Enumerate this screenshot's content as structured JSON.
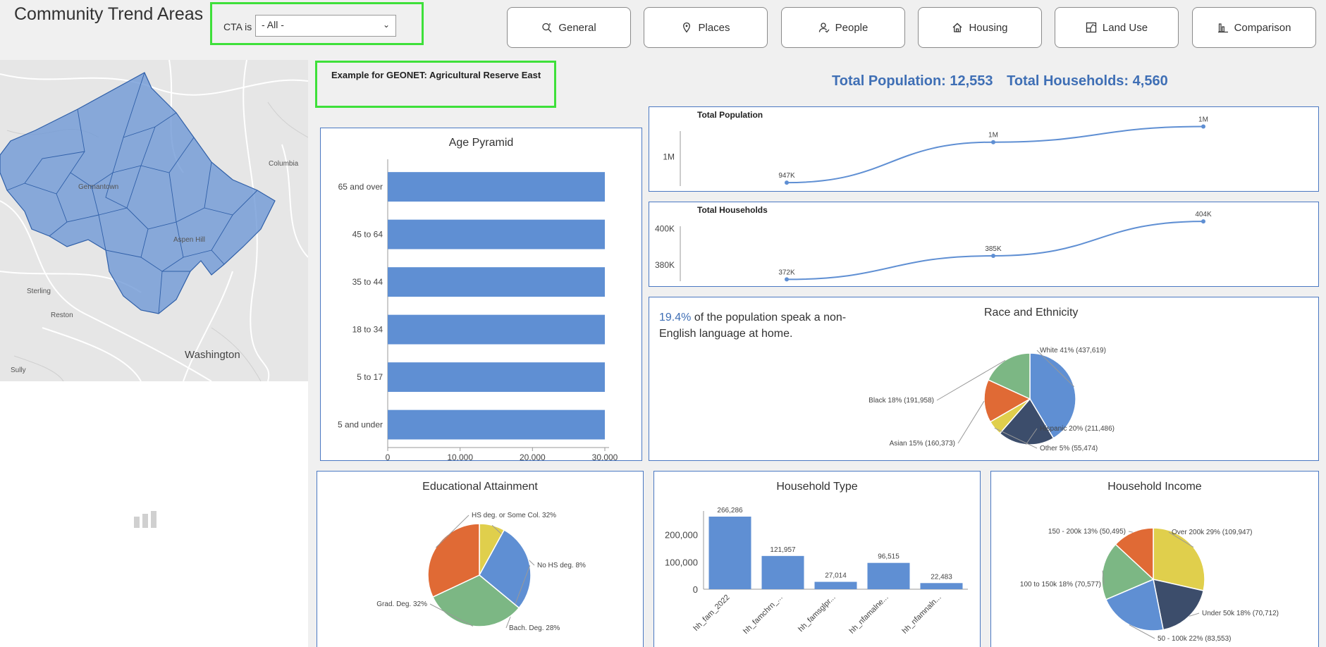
{
  "header": {
    "title": "Community Trend Areas",
    "filter_label": "CTA is",
    "filter_value": "- All -"
  },
  "nav": {
    "buttons": [
      {
        "label": "General",
        "icon": "search-chart-icon"
      },
      {
        "label": "Places",
        "icon": "map-pin-icon"
      },
      {
        "label": "People",
        "icon": "person-icon"
      },
      {
        "label": "Housing",
        "icon": "home-icon"
      },
      {
        "label": "Land Use",
        "icon": "land-use-icon"
      },
      {
        "label": "Comparison",
        "icon": "bar-chart-icon"
      }
    ]
  },
  "map": {
    "places": [
      "Germantown",
      "Columbia",
      "Aspen Hill",
      "Sterling",
      "Reston",
      "Washington",
      "Sully"
    ]
  },
  "geonet_note": "Example for GEONET: Agricultural Reserve East",
  "totals": {
    "population_text": "Total Population: 12,553",
    "households_text": "Total Households: 4,560"
  },
  "language": {
    "pct": "19.4%",
    "text": "of the population speak a non-English language at home."
  },
  "colors": {
    "blue": "#5f8fd3",
    "green": "#7cb784",
    "orange": "#e06a35",
    "yellow": "#e0cf4c",
    "navy": "#3c4d6b",
    "accent": "#3f6fb5",
    "highlight_border": "#3ee03a"
  },
  "chart_data": [
    {
      "type": "bar",
      "title": "Age Pyramid",
      "orientation": "horizontal",
      "categories": [
        "65 and over",
        "45 to 64",
        "35 to 44",
        "18 to 34",
        "5 to 17",
        "5 and under"
      ],
      "values": [
        30000,
        30000,
        30000,
        30000,
        30000,
        30000
      ],
      "xlim": [
        0,
        30000
      ],
      "xticks": [
        "0",
        "10,000",
        "20,000",
        "30,000"
      ]
    },
    {
      "type": "line",
      "title": "Total Population",
      "points": [
        {
          "label": "947K",
          "y": 947000
        },
        {
          "label": "1M",
          "y": 1030000
        },
        {
          "label": "1M",
          "y": 1062000
        }
      ],
      "ytick_label": "1M"
    },
    {
      "type": "line",
      "title": "Total Households",
      "points": [
        {
          "label": "372K",
          "y": 372000
        },
        {
          "label": "385K",
          "y": 385000
        },
        {
          "label": "404K",
          "y": 404000
        }
      ],
      "yticks": [
        {
          "label": "400K",
          "y": 400000
        },
        {
          "label": "380K",
          "y": 380000
        }
      ]
    },
    {
      "type": "pie",
      "title": "Race and Ethnicity",
      "slices": [
        {
          "label": "White 41% (437,619)",
          "value": 437619,
          "color": "#5f8fd3"
        },
        {
          "label": "Hispanic 20% (211,486)",
          "value": 211486,
          "color": "#3c4d6b"
        },
        {
          "label": "Other 5% (55,474)",
          "value": 55474,
          "color": "#e0cf4c"
        },
        {
          "label": "Asian 15% (160,373)",
          "value": 160373,
          "color": "#e06a35"
        },
        {
          "label": "Black 18% (191,958)",
          "value": 191958,
          "color": "#7cb784"
        }
      ]
    },
    {
      "type": "pie",
      "title": "Educational Attainment",
      "slices": [
        {
          "label": "No HS deg. 8%",
          "value": 8,
          "color": "#e0cf4c"
        },
        {
          "label": "Bach. Deg. 28%",
          "value": 28,
          "color": "#5f8fd3"
        },
        {
          "label": "Grad. Deg. 32%",
          "value": 32,
          "color": "#7cb784"
        },
        {
          "label": "HS deg. or Some Col. 32%",
          "value": 32,
          "color": "#e06a35"
        }
      ]
    },
    {
      "type": "bar",
      "title": "Household Type",
      "categories": [
        "hh_fam_2022",
        "hh_famchrn_...",
        "hh_famsglpr...",
        "hh_nfamalne...",
        "hh_nfamnaln..."
      ],
      "values": [
        266286,
        121957,
        27014,
        96515,
        22483
      ],
      "value_labels": [
        "266,286",
        "121,957",
        "27,014",
        "96,515",
        "22,483"
      ],
      "ylim": [
        0,
        266286
      ],
      "yticks": [
        {
          "label": "200,000",
          "y": 200000
        },
        {
          "label": "100,000",
          "y": 100000
        },
        {
          "label": "0",
          "y": 0
        }
      ]
    },
    {
      "type": "pie",
      "title": "Household Income",
      "slices": [
        {
          "label": "Over 200k 29% (109,947)",
          "value": 109947,
          "color": "#e0cf4c"
        },
        {
          "label": "Under 50k 18% (70,712)",
          "value": 70712,
          "color": "#3c4d6b"
        },
        {
          "label": "50 - 100k 22% (83,553)",
          "value": 83553,
          "color": "#5f8fd3"
        },
        {
          "label": "100 to 150k 18% (70,577)",
          "value": 70577,
          "color": "#7cb784"
        },
        {
          "label": "150 - 200k 13% (50,495)",
          "value": 50495,
          "color": "#e06a35"
        }
      ]
    }
  ]
}
